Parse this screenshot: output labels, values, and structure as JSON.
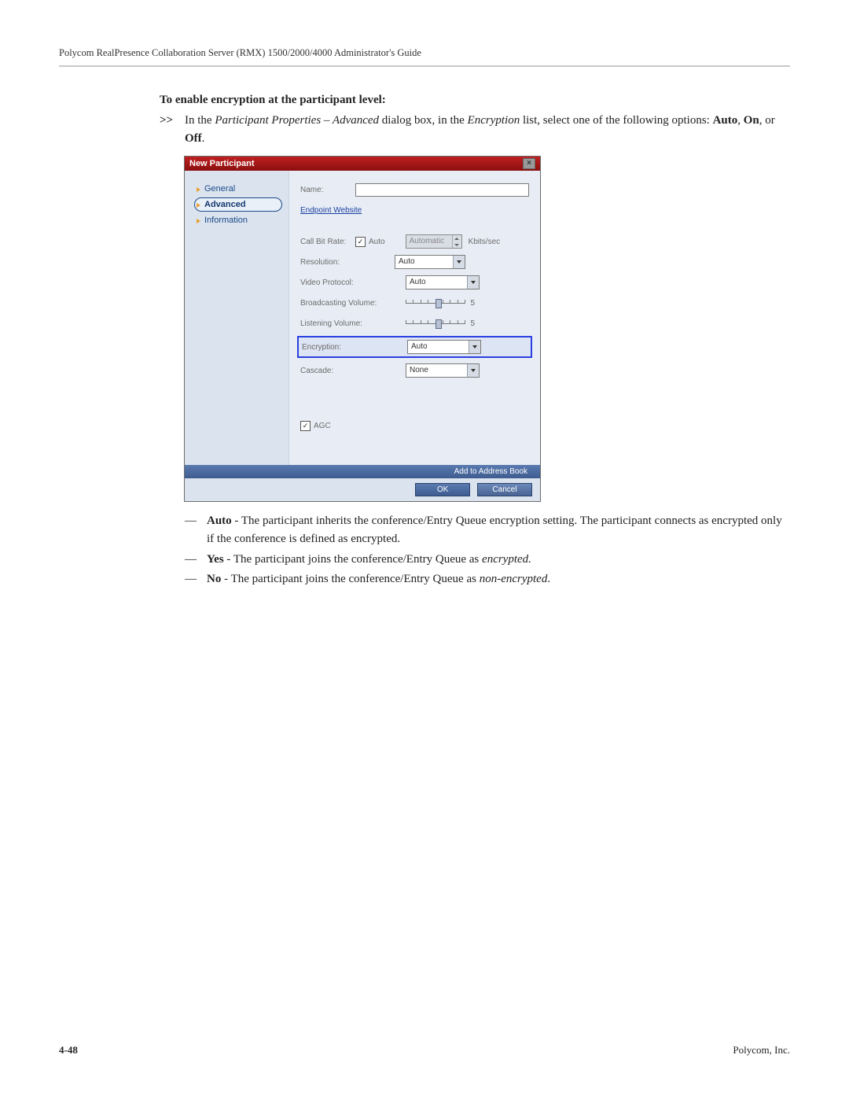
{
  "header": "Polycom RealPresence Collaboration Server (RMX) 1500/2000/4000 Administrator's Guide",
  "section_heading": "To enable encryption at the participant level:",
  "step": {
    "marker": ">>",
    "pre": "In the ",
    "ital1": "Participant Properties – Advanced",
    "mid1": " dialog box, in the ",
    "ital2": "Encryption",
    "mid2": " list, select one of the following options: ",
    "bold1": "Auto",
    "sep1": ", ",
    "bold2": "On",
    "sep2": ", or ",
    "bold3": "Off",
    "tail": "."
  },
  "dialog": {
    "title": "New Participant",
    "sidebar": {
      "general": "General",
      "advanced": "Advanced",
      "information": "Information"
    },
    "labels": {
      "name": "Name:",
      "endpoint_website": "Endpoint Website",
      "call_bit_rate": "Call Bit Rate:",
      "auto_chk": "Auto",
      "automatic": "Automatic",
      "kbits": "Kbits/sec",
      "resolution": "Resolution:",
      "video_protocol": "Video Protocol:",
      "broadcasting_volume": "Broadcasting Volume:",
      "listening_volume": "Listening Volume:",
      "encryption": "Encryption:",
      "cascade": "Cascade:",
      "agc": "AGC"
    },
    "values": {
      "resolution": "Auto",
      "video_protocol": "Auto",
      "encryption": "Auto",
      "cascade": "None",
      "broadcasting_volume": "5",
      "listening_volume": "5"
    },
    "footer": {
      "add_to_ab": "Add to Address Book",
      "ok": "OK",
      "cancel": "Cancel"
    }
  },
  "bullets": {
    "auto": {
      "label": "Auto",
      "text": " - The participant inherits the conference/Entry Queue encryption setting. The participant connects as encrypted only if the conference is defined as encrypted."
    },
    "yes": {
      "label": "Yes",
      "pre": " - The participant joins the conference/Entry Queue as ",
      "ital": "encrypted.",
      "post": ""
    },
    "no": {
      "label": "No",
      "pre": " - The participant joins the conference/Entry Queue as ",
      "ital": "non-encrypted",
      "post": "."
    }
  },
  "footer": {
    "page": "4-48",
    "company": "Polycom, Inc."
  }
}
